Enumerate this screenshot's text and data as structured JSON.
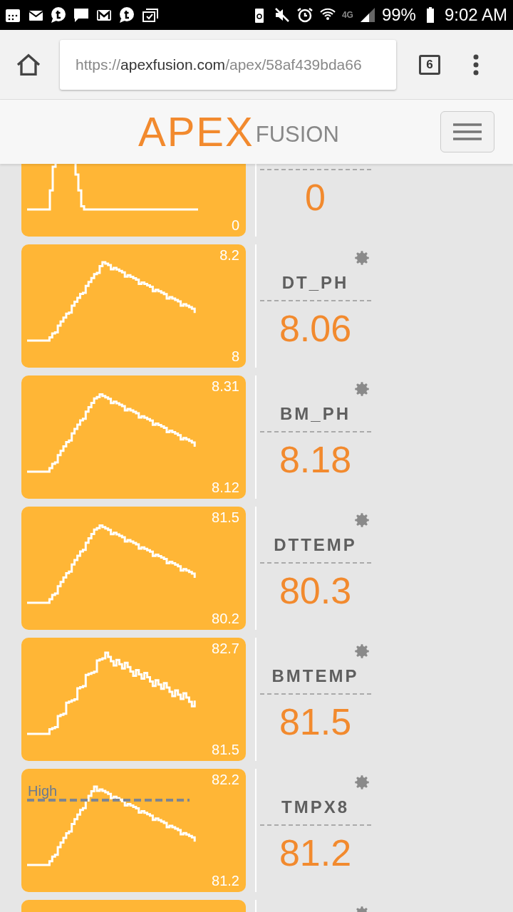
{
  "status_bar": {
    "time": "9:02 AM",
    "battery": "99%",
    "network": "4G"
  },
  "browser": {
    "url": {
      "scheme": "https://",
      "host": "apexfusion.com",
      "path": "/apex/58af439bda66"
    },
    "tab_count": "6"
  },
  "header": {
    "logo": {
      "main": "APEX",
      "sub": "FUSION"
    }
  },
  "rows": [
    {
      "min": "0",
      "value": "0"
    },
    {
      "name": "DT_PH",
      "max": "8.2",
      "min": "8",
      "value": "8.06"
    },
    {
      "name": "BM_PH",
      "max": "8.31",
      "min": "8.12",
      "value": "8.18"
    },
    {
      "name": "DTTEMP",
      "max": "81.5",
      "min": "80.2",
      "value": "80.3"
    },
    {
      "name": "BMTEMP",
      "max": "82.7",
      "min": "81.5",
      "value": "81.5"
    },
    {
      "name": "TMPX8",
      "max": "82.2",
      "min": "81.2",
      "value": "81.2",
      "threshold": {
        "label": "High"
      }
    },
    {}
  ]
}
